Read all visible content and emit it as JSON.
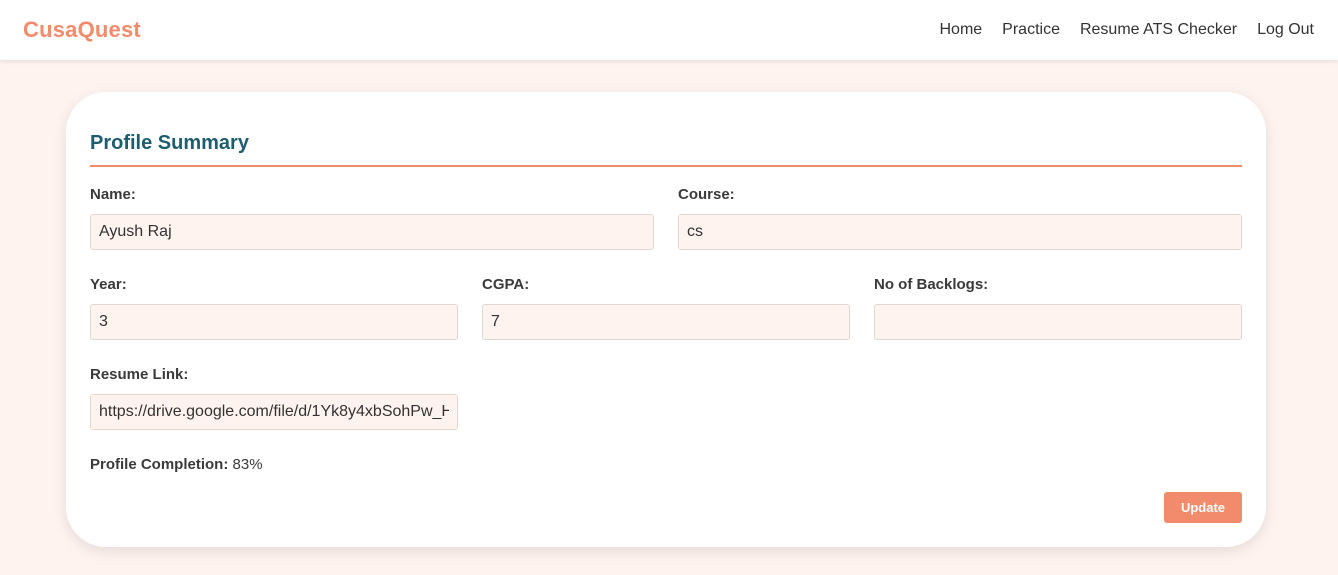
{
  "app": {
    "brand": "CusaQuest",
    "accent_color": "#f28b6b",
    "title_color": "#1e5d6e"
  },
  "nav": {
    "items": [
      {
        "label": "Home"
      },
      {
        "label": "Practice"
      },
      {
        "label": "Resume ATS Checker"
      },
      {
        "label": "Log Out"
      }
    ]
  },
  "profile": {
    "title": "Profile Summary",
    "fields": {
      "name": {
        "label": "Name:",
        "value": "Ayush Raj"
      },
      "course": {
        "label": "Course:",
        "value": "cs"
      },
      "year": {
        "label": "Year:",
        "value": "3"
      },
      "cgpa": {
        "label": "CGPA:",
        "value": "7"
      },
      "backlogs": {
        "label": "No of Backlogs:",
        "value": ""
      },
      "resume": {
        "label": "Resume Link:",
        "value": "https://drive.google.com/file/d/1Yk8y4xbSohPw_H"
      }
    },
    "completion_label": "Profile Completion:",
    "completion_value": "83%",
    "completion_fraction": 0.83,
    "update_label": "Update"
  }
}
